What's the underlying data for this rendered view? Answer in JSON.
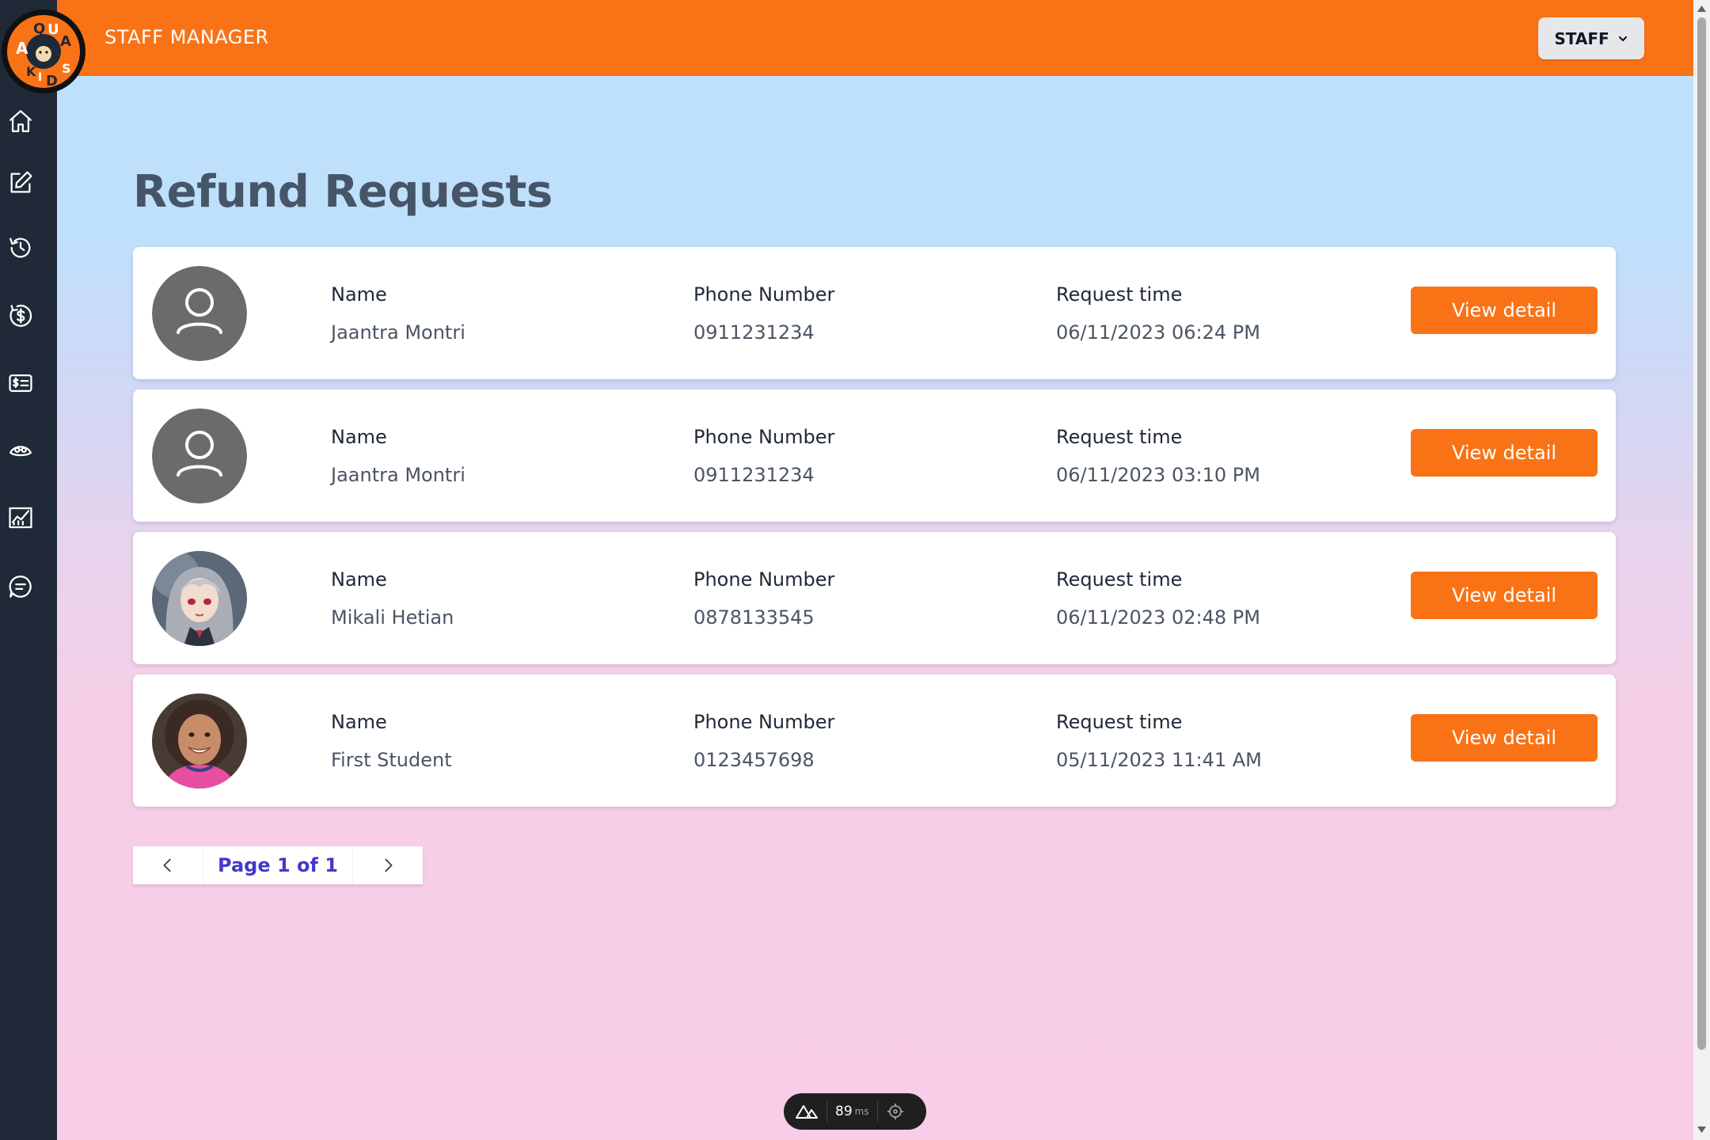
{
  "header": {
    "app_title": "STAFF MANAGER",
    "user_menu_label": "STAFF"
  },
  "logo": {
    "letters": [
      "A",
      "Q",
      "U",
      "A",
      "K",
      "I",
      "D",
      "S"
    ]
  },
  "sidebar": {
    "items": [
      {
        "icon": "home-icon"
      },
      {
        "icon": "edit-icon"
      },
      {
        "icon": "history-icon"
      },
      {
        "icon": "dollar-icon"
      },
      {
        "icon": "id-card-icon"
      },
      {
        "icon": "swimmer-icon"
      },
      {
        "icon": "chart-icon"
      },
      {
        "icon": "chat-icon"
      }
    ]
  },
  "page": {
    "title": "Refund Requests"
  },
  "labels": {
    "name": "Name",
    "phone": "Phone Number",
    "time": "Request time",
    "view_detail": "View detail"
  },
  "requests": [
    {
      "name": "Jaantra Montri",
      "phone": "0911231234",
      "time": "06/11/2023 06:24 PM",
      "avatar": "default-user"
    },
    {
      "name": "Jaantra Montri",
      "phone": "0911231234",
      "time": "06/11/2023 03:10 PM",
      "avatar": "default-user"
    },
    {
      "name": "Mikali Hetian",
      "phone": "0878133545",
      "time": "06/11/2023 02:48 PM",
      "avatar": "anime-portrait"
    },
    {
      "name": "First Student",
      "phone": "0123457698",
      "time": "05/11/2023 11:41 AM",
      "avatar": "child-portrait"
    }
  ],
  "pagination": {
    "label": "Page 1 of 1"
  },
  "dev_badge": {
    "value": "89",
    "unit": "ms"
  },
  "colors": {
    "accent": "#f97316",
    "sidebar": "#1f2937",
    "pager_text": "#4338ca"
  }
}
